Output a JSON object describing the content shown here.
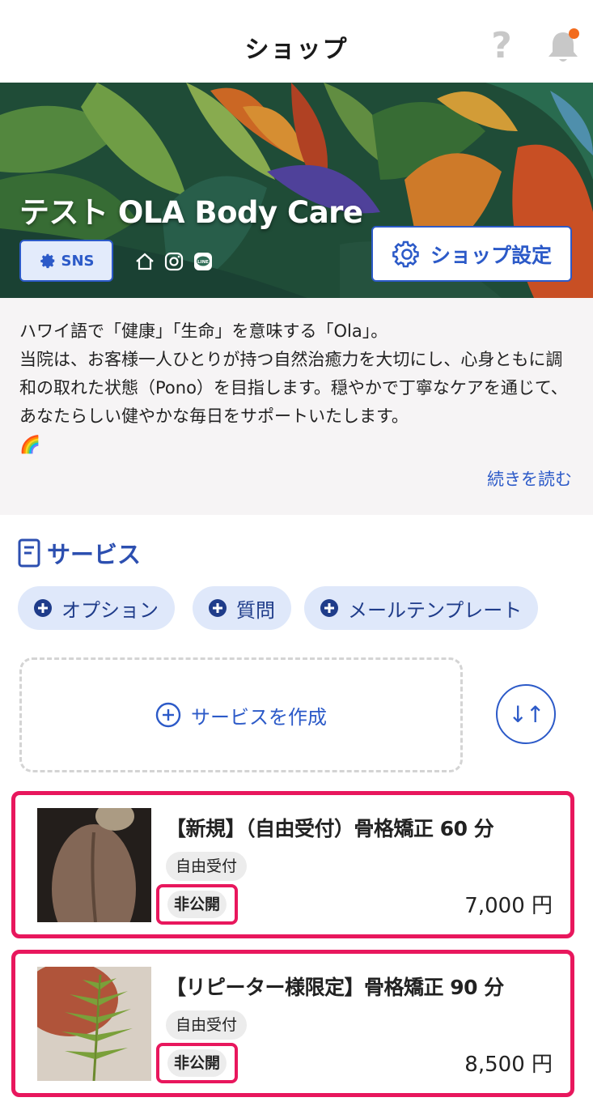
{
  "header": {
    "title": "ショップ",
    "help_icon": "question-mark-icon",
    "notification_icon": "bell-icon",
    "notification_dot_color": "#f26b1d"
  },
  "banner": {
    "shop_name": "テスト OLA Body Care",
    "sns_button_label": "SNS",
    "social_icons": [
      "home-icon",
      "instagram-icon",
      "line-icon"
    ],
    "settings_button_label": "ショップ設定"
  },
  "description": {
    "text": "ハワイ語で「健康」「生命」を意味する「Ola」。\n当院は、お客様一人ひとりが持つ自然治癒力を大切にし、心身ともに調和の取れた状態（Pono）を目指します。穏やかで丁寧なケアを通じて、あなたらしい健やかな毎日をサポートいたします。\n🌈",
    "read_more": "続きを読む"
  },
  "services": {
    "section_title": "サービス",
    "chips": [
      "オプション",
      "質問",
      "メールテンプレート"
    ],
    "create_label": "サービスを作成",
    "sort_label": "↓↑",
    "items": [
      {
        "title": "【新規】（自由受付）骨格矯正 60 分",
        "tag": "自由受付",
        "visibility": "非公開",
        "price": "7,000 円"
      },
      {
        "title": "【リピーター様限定】骨格矯正 90 分",
        "tag": "自由受付",
        "visibility": "非公開",
        "price": "8,500 円"
      }
    ]
  },
  "colors": {
    "accent": "#2c5ac8",
    "highlight": "#e8175d",
    "chip_bg": "#dfe8fa"
  }
}
